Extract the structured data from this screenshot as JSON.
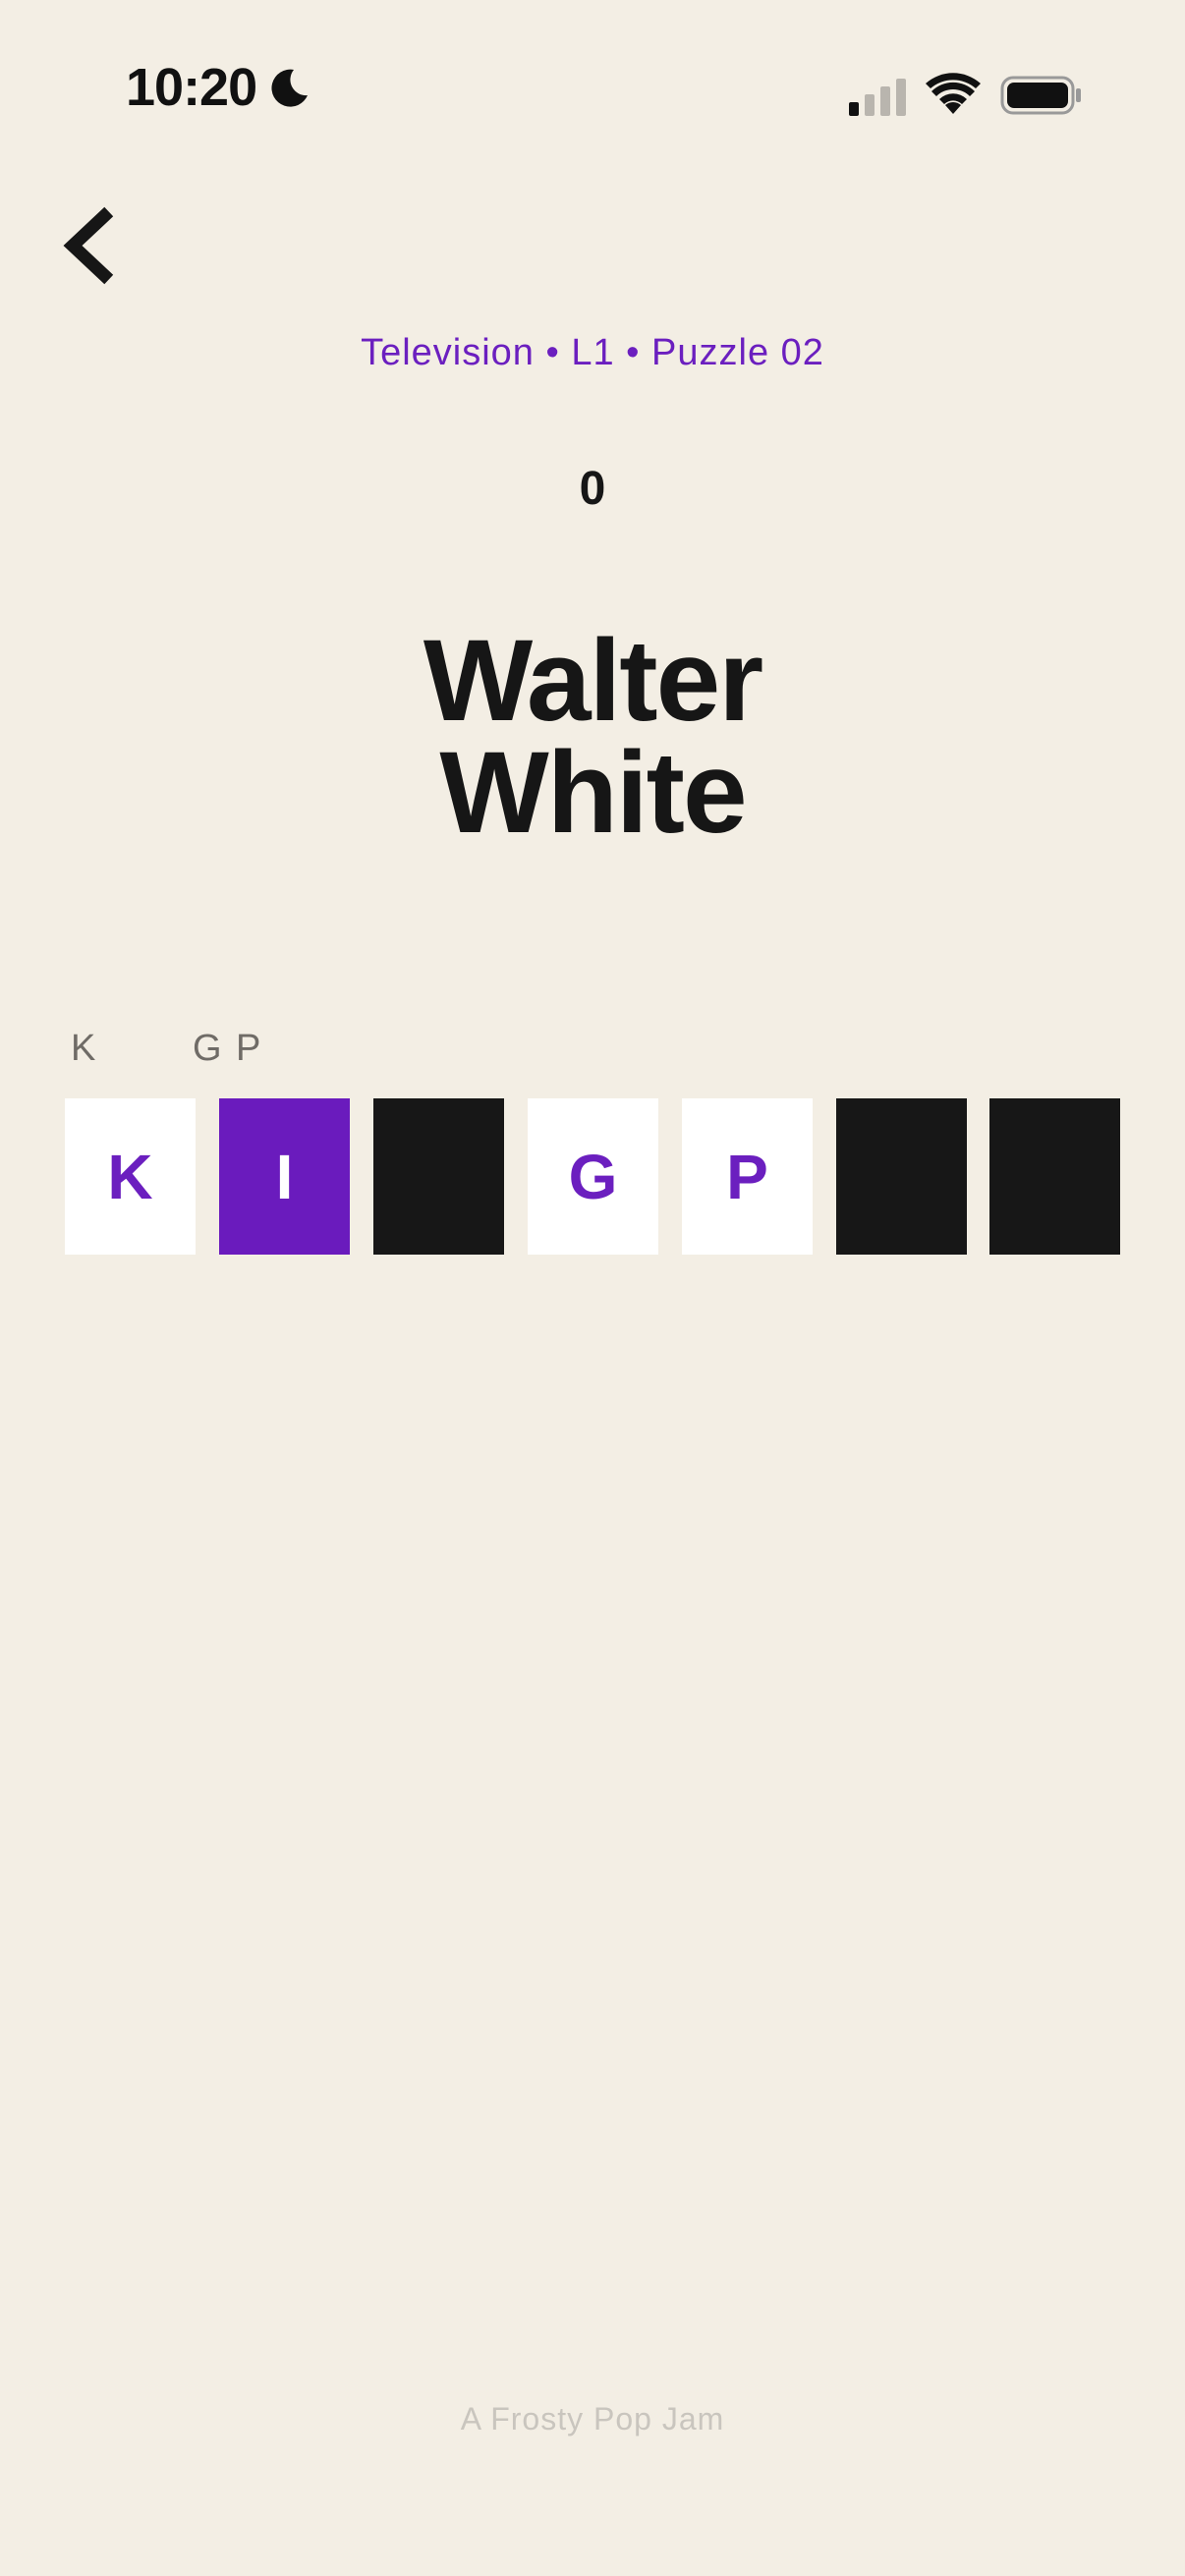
{
  "status_bar": {
    "time": "10:20",
    "icons": [
      "moon-icon",
      "cellular-signal-icon",
      "wifi-icon",
      "battery-icon"
    ]
  },
  "nav": {
    "back_icon": "chevron-left-icon"
  },
  "puzzle": {
    "subtitle": "Television • L1 • Puzzle 02",
    "score": "0",
    "clue_line1": "Walter",
    "clue_line2": "White"
  },
  "hints": [
    "K",
    "G",
    "P"
  ],
  "tiles": [
    {
      "letter": "K",
      "state": "revealed"
    },
    {
      "letter": "I",
      "state": "selected"
    },
    {
      "letter": "",
      "state": "hidden"
    },
    {
      "letter": "G",
      "state": "revealed"
    },
    {
      "letter": "P",
      "state": "revealed"
    },
    {
      "letter": "",
      "state": "hidden"
    },
    {
      "letter": "",
      "state": "hidden"
    }
  ],
  "footer": {
    "credit": "A Frosty Pop Jam"
  },
  "colors": {
    "background": "#f3eee4",
    "accent": "#6b1fbf",
    "tile_hidden": "#171717",
    "tile_revealed": "#ffffff"
  }
}
